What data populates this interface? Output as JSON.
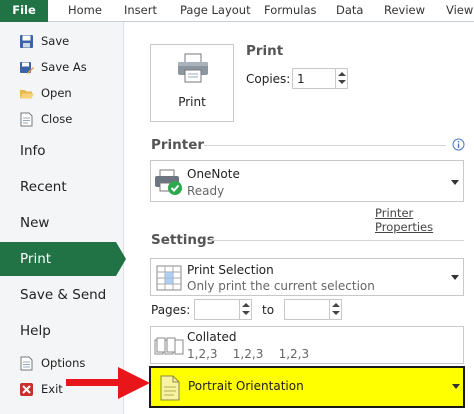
{
  "ribbon": {
    "tabs": [
      "File",
      "Home",
      "Insert",
      "Page Layout",
      "Formulas",
      "Data",
      "Review",
      "View"
    ]
  },
  "nav": {
    "save": "Save",
    "save_as": "Save As",
    "open": "Open",
    "close": "Close",
    "info": "Info",
    "recent": "Recent",
    "new": "New",
    "print": "Print",
    "save_send": "Save & Send",
    "help": "Help",
    "options": "Options",
    "exit": "Exit"
  },
  "print_section": {
    "heading": "Print",
    "button_label": "Print",
    "copies_label": "Copies:",
    "copies_value": "1"
  },
  "printer": {
    "heading": "Printer",
    "name": "OneNote",
    "status": "Ready",
    "properties_link": "Printer Properties"
  },
  "settings": {
    "heading": "Settings",
    "print_what": {
      "title": "Print Selection",
      "subtitle": "Only print the current selection"
    },
    "pages_label": "Pages:",
    "pages_from": "",
    "to_label": "to",
    "pages_to": "",
    "collation": {
      "title": "Collated",
      "subtitle": "1,2,3    1,2,3    1,2,3"
    },
    "orientation": {
      "title": "Portrait Orientation",
      "highlighted": true
    }
  },
  "colors": {
    "accent": "#217346",
    "highlight": "#ffff00",
    "highlight_border": "#1a1a1a",
    "arrow": "#e8161a"
  }
}
